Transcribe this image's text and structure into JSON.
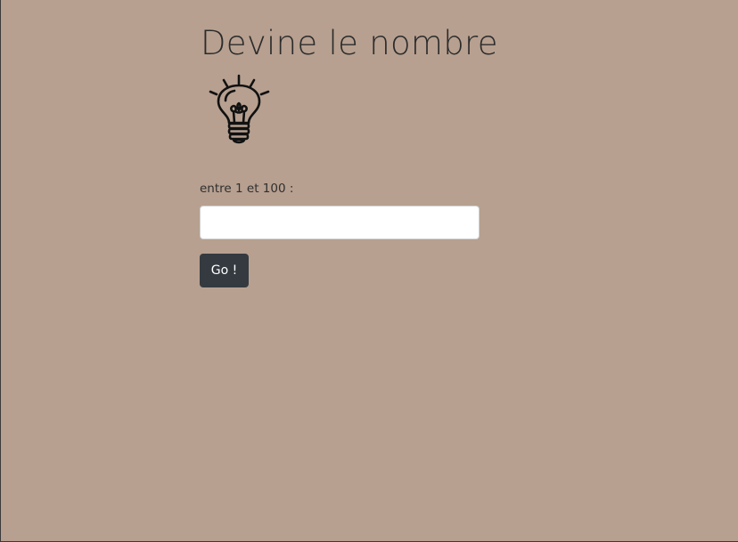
{
  "page": {
    "title": "Devine le nombre",
    "background_color": "#b7a090"
  },
  "hero": {
    "icon": "lightbulb-icon"
  },
  "form": {
    "label": "entre 1 et 100 :",
    "input_value": "",
    "input_placeholder": "",
    "submit_label": "Go !",
    "submit_color": "#343a40"
  }
}
